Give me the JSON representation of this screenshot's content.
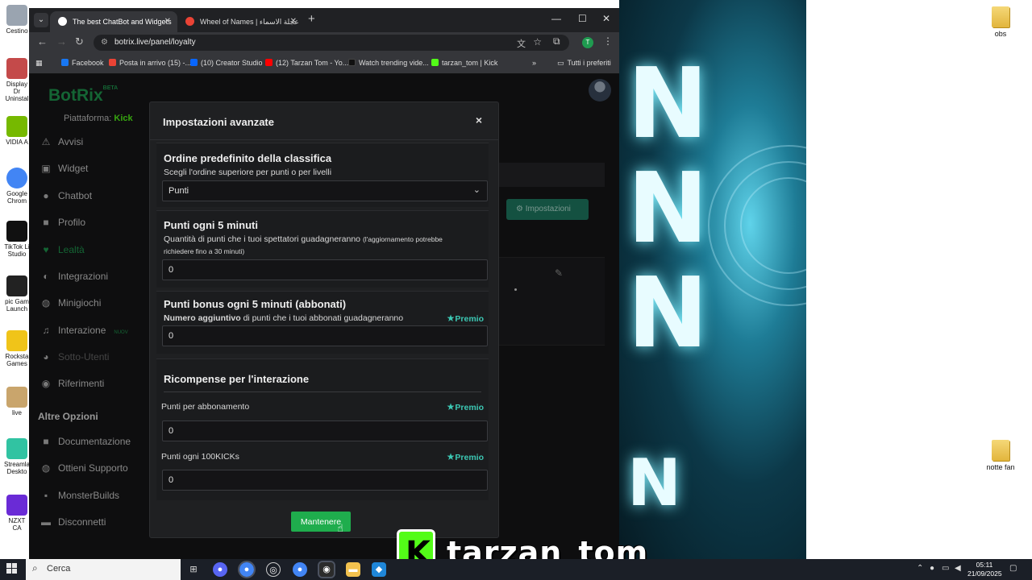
{
  "desktop": {
    "left_icons": [
      {
        "label": "Cestino",
        "color": "#9aa4b0"
      },
      {
        "label": "Display Dr Uninstal",
        "color": "#c44a4a"
      },
      {
        "label": "VIDIA A",
        "color": "#76b900"
      },
      {
        "label": "Google Chrom",
        "color": "#4285f4"
      },
      {
        "label": "TikTok Li Studio",
        "color": "#111111"
      },
      {
        "label": "pic Gam Launch",
        "color": "#222222"
      },
      {
        "label": "Rocksta Games",
        "color": "#f0c419"
      },
      {
        "label": "live",
        "color": "#c9a56c"
      },
      {
        "label": "Streamla Deskto",
        "color": "#31c3a2"
      },
      {
        "label": "NZXT CA",
        "color": "#6a2bd6"
      }
    ],
    "right_icons": [
      {
        "label": "obs"
      },
      {
        "label": "notte fan"
      }
    ]
  },
  "browser": {
    "tabs": [
      {
        "title": "The best ChatBot and Widgets",
        "active": true,
        "favicon_color": "#ffffff"
      },
      {
        "title": "Wheel of Names | عجلة الاسماء",
        "active": false,
        "favicon_color": "#ea4335"
      }
    ],
    "url": "botrix.live/panel/loyalty",
    "profile_initial": "T",
    "bookmarks": [
      {
        "label": "Facebook",
        "color": "#1877f2"
      },
      {
        "label": "Posta in arrivo (15) -...",
        "color": "#ea4335"
      },
      {
        "label": "(10) Creator Studio",
        "color": "#0866ff"
      },
      {
        "label": "(12) Tarzan Tom - Yo...",
        "color": "#ff0000"
      },
      {
        "label": "Watch trending vide...",
        "color": "#111111"
      },
      {
        "label": "tarzan_tom | Kick",
        "color": "#53fc18"
      }
    ],
    "bookmarks_more": "»",
    "all_bookmarks": "Tutti i preferiti"
  },
  "app": {
    "brand": "BotRix",
    "brand_badge": "BETA",
    "platform_label": "Piattaforma:",
    "platform_value": "Kick",
    "sidebar": [
      {
        "label": "Avvisi",
        "icon": "⚠"
      },
      {
        "label": "Widget",
        "icon": "▣"
      },
      {
        "label": "Chatbot",
        "icon": "●"
      },
      {
        "label": "Profilo",
        "icon": "■"
      },
      {
        "label": "Lealtà",
        "icon": "♥"
      },
      {
        "label": "Integrazioni",
        "icon": "◐"
      },
      {
        "label": "Minigiochi",
        "icon": "◍"
      },
      {
        "label": "Interazione",
        "icon": "♫"
      },
      {
        "label": "Sotto-Utenti",
        "icon": "◕"
      },
      {
        "label": "Riferimenti",
        "icon": "◉"
      }
    ],
    "sidebar_new_badge": "NUOV",
    "other_options_heading": "Altre Opzioni",
    "other_options": [
      {
        "label": "Documentazione",
        "icon": "■"
      },
      {
        "label": "Ottieni Supporto",
        "icon": "◍"
      },
      {
        "label": "MonsterBuilds",
        "icon": "▪"
      },
      {
        "label": "Disconnetti",
        "icon": "▬"
      }
    ],
    "settings_button": "Impostazioni"
  },
  "modal": {
    "title": "Impostazioni avanzate",
    "close": "×",
    "sections": {
      "ranking": {
        "title": "Ordine predefinito della classifica",
        "desc": "Scegli l'ordine superiore per punti o per livelli",
        "selected": "Punti"
      },
      "points5": {
        "title": "Punti ogni 5 minuti",
        "desc": "Quantità di punti che i tuoi spettatori guadagneranno",
        "desc_small": "(l'aggiornamento potrebbe richiedere fino a 30 minuti)",
        "value": "0"
      },
      "bonus5": {
        "title": "Punti bonus ogni 5 minuti (abbonati)",
        "desc_bold": "Numero aggiuntivo",
        "desc": " di punti che i tuoi abbonati guadagneranno",
        "badge": "Premio",
        "value": "0"
      },
      "rewards": {
        "title": "Ricompense per l'interazione",
        "sub_label": "Punti per abbonamento",
        "sub_badge": "Premio",
        "sub_value": "0",
        "kicks_label": "Punti ogni 100KICKs",
        "kicks_badge": "Premio",
        "kicks_value": "0"
      }
    },
    "save_label": "Mantenere"
  },
  "overlay": {
    "kick_letter": "K",
    "streamer": "tarzan_tom"
  },
  "taskbar": {
    "search_placeholder": "Cerca",
    "time": "05:11",
    "date": "21/09/2025"
  }
}
